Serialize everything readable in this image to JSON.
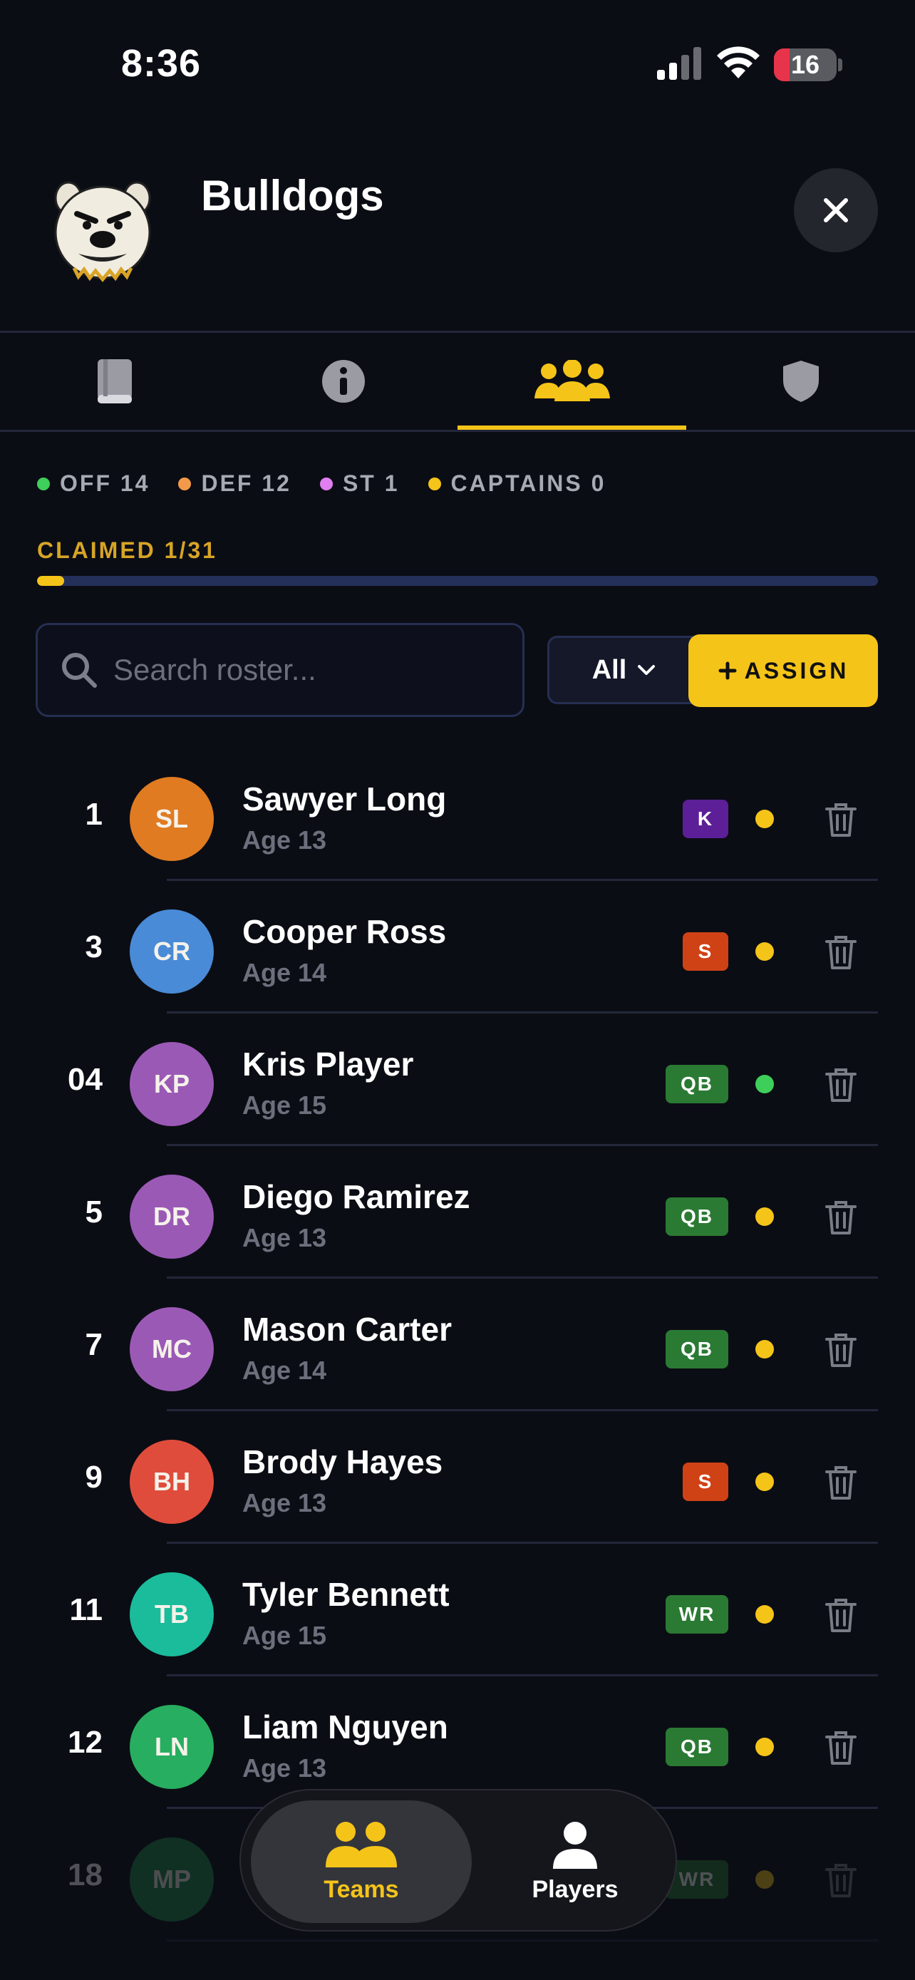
{
  "status_bar": {
    "time": "8:36",
    "battery": "16"
  },
  "team": {
    "name": "Bulldogs"
  },
  "tabs": [
    {
      "name": "playbook",
      "icon": "book-icon"
    },
    {
      "name": "info",
      "icon": "info-icon"
    },
    {
      "name": "roster",
      "icon": "users-icon",
      "active": true
    },
    {
      "name": "shield",
      "icon": "shield-icon"
    }
  ],
  "counts": [
    {
      "label": "OFF 14",
      "color": "#3ecf5a"
    },
    {
      "label": "DEF 12",
      "color": "#f39a4a"
    },
    {
      "label": "ST 1",
      "color": "#e07ff0"
    },
    {
      "label": "CAPTAINS 0",
      "color": "#f5c419"
    }
  ],
  "claimed": {
    "label": "CLAIMED 1/31",
    "fraction": 0.0323
  },
  "search": {
    "placeholder": "Search roster..."
  },
  "filter": {
    "label": "All"
  },
  "assign": {
    "label": "ASSIGN"
  },
  "roster": [
    {
      "number": "1",
      "initials": "SL",
      "name": "Sawyer Long",
      "age": "Age 13",
      "pos": "K",
      "avatar_color": "#e07b22",
      "badge_color": "#5c1f97",
      "status_color": "#f5c419"
    },
    {
      "number": "3",
      "initials": "CR",
      "name": "Cooper Ross",
      "age": "Age 14",
      "pos": "S",
      "avatar_color": "#4a8bd8",
      "badge_color": "#cf4216",
      "status_color": "#f5c419"
    },
    {
      "number": "04",
      "initials": "KP",
      "name": "Kris Player",
      "age": "Age 15",
      "pos": "QB",
      "avatar_color": "#9b59b6",
      "badge_color": "#2a7a33",
      "status_color": "#3ecf5a"
    },
    {
      "number": "5",
      "initials": "DR",
      "name": "Diego Ramirez",
      "age": "Age 13",
      "pos": "QB",
      "avatar_color": "#9b59b6",
      "badge_color": "#2a7a33",
      "status_color": "#f5c419"
    },
    {
      "number": "7",
      "initials": "MC",
      "name": "Mason Carter",
      "age": "Age 14",
      "pos": "QB",
      "avatar_color": "#9b59b6",
      "badge_color": "#2a7a33",
      "status_color": "#f5c419"
    },
    {
      "number": "9",
      "initials": "BH",
      "name": "Brody Hayes",
      "age": "Age 13",
      "pos": "S",
      "avatar_color": "#e04c3c",
      "badge_color": "#cf4216",
      "status_color": "#f5c419"
    },
    {
      "number": "11",
      "initials": "TB",
      "name": "Tyler Bennett",
      "age": "Age 15",
      "pos": "WR",
      "avatar_color": "#1abc9c",
      "badge_color": "#2a7a33",
      "status_color": "#f5c419"
    },
    {
      "number": "12",
      "initials": "LN",
      "name": "Liam Nguyen",
      "age": "Age 13",
      "pos": "QB",
      "avatar_color": "#27ae60",
      "badge_color": "#2a7a33",
      "status_color": "#f5c419"
    },
    {
      "number": "18",
      "initials": "MP",
      "name": "",
      "age": "",
      "pos": "WR",
      "avatar_color": "#1f8a4a",
      "badge_color": "#2a7a33",
      "status_color": "#f5c419"
    }
  ],
  "nav": [
    {
      "label": "Teams",
      "icon": "teams-icon",
      "active": true
    },
    {
      "label": "Players",
      "icon": "player-icon",
      "active": false
    }
  ]
}
